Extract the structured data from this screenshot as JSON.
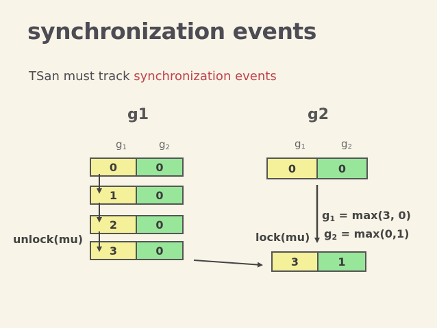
{
  "title": "synchronization events",
  "subtitle": {
    "prefix": "TSan must track ",
    "highlight": "synchronization events"
  },
  "g1": {
    "title": "g1",
    "col1_base": "g",
    "col1_sub": "1",
    "col2_base": "g",
    "col2_sub": "2",
    "rows": [
      {
        "a": "0",
        "b": "0"
      },
      {
        "a": "1",
        "b": "0"
      },
      {
        "a": "2",
        "b": "0"
      },
      {
        "a": "3",
        "b": "0"
      }
    ],
    "event_label": "unlock(mu)"
  },
  "g2": {
    "title": "g2",
    "col1_base": "g",
    "col1_sub": "1",
    "col2_base": "g",
    "col2_sub": "2",
    "rows": [
      {
        "a": "0",
        "b": "0"
      },
      {
        "a": "3",
        "b": "1"
      }
    ],
    "event_label": "lock(mu)",
    "formula1_base": "g",
    "formula1_sub": "1",
    "formula1_rest": " = max(3, 0)",
    "formula2_base": "g",
    "formula2_sub": "2",
    "formula2_rest": " = max(0,1)"
  },
  "colors": {
    "background": "#f8f4e7",
    "title": "#4d4b54",
    "highlight": "#c0414b",
    "cell_yellow": "#f5f09a",
    "cell_green": "#98e69a",
    "border": "#555555"
  }
}
